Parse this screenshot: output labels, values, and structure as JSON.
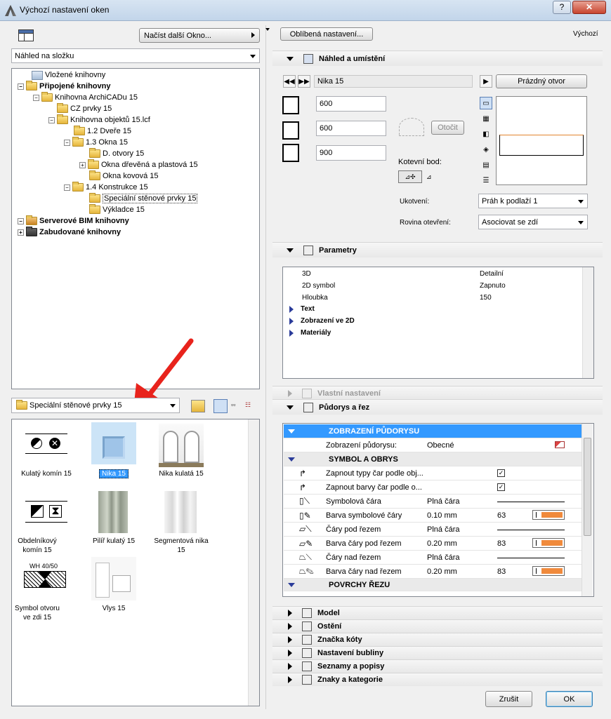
{
  "window": {
    "title": "Výchozí nastavení oken",
    "help": "?",
    "close": "✕"
  },
  "left": {
    "load_button": "Načíst další Okno...",
    "view_mode": "Náhled na složku",
    "tree": [
      {
        "label": "Vložené knihovny",
        "bold": false
      },
      {
        "label": "Připojené knihovny",
        "bold": true
      },
      {
        "label": "Knihovna ArchiCADu 15",
        "bold": false
      },
      {
        "label": "CZ prvky 15",
        "bold": false
      },
      {
        "label": "Knihovna objektů 15.lcf",
        "bold": false
      },
      {
        "label": "1.2 Dveře 15",
        "bold": false
      },
      {
        "label": "1.3 Okna 15",
        "bold": false
      },
      {
        "label": "D. otvory 15",
        "bold": false
      },
      {
        "label": "Okna dřevěná a plastová 15",
        "bold": false
      },
      {
        "label": "Okna kovová 15",
        "bold": false
      },
      {
        "label": "1.4 Konstrukce 15",
        "bold": false
      },
      {
        "label": "Speciální stěnové prvky 15",
        "bold": false
      },
      {
        "label": "Výkladce 15",
        "bold": false
      },
      {
        "label": "Serverové BIM knihovny",
        "bold": true
      },
      {
        "label": "Zabudované knihovny",
        "bold": true
      }
    ],
    "folder_select": "Speciální stěnové prvky 15",
    "items": [
      {
        "label": "Kulatý komín 15"
      },
      {
        "label": "Nika 15"
      },
      {
        "label": "Nika kulatá 15"
      },
      {
        "label": "Obdelníkový komín 15"
      },
      {
        "label": "Pilíř kulatý 15"
      },
      {
        "label": "Segmentová nika 15"
      },
      {
        "label": "Symbol otvoru ve zdi 15",
        "tag": "WH 40/50"
      },
      {
        "label": "Vlys 15"
      }
    ]
  },
  "right": {
    "favorites_button": "Oblíbená nastavení...",
    "default_label": "Výchozí",
    "preview_section": "Náhled a umístění",
    "object_name": "Nika 15",
    "empty_opening": "Prázdný otvor",
    "width": "600",
    "height": "600",
    "depth": "900",
    "rotate": "Otočit",
    "anchor_label": "Kotevní bod:",
    "anchoring_label": "Ukotvení:",
    "anchoring_value": "Práh k podlaží 1",
    "opening_plane_label": "Rovina otevření:",
    "opening_plane_value": "Asociovat se zdí",
    "params_section": "Parametry",
    "params": [
      {
        "name": "3D",
        "value": "Detailní"
      },
      {
        "name": "2D symbol",
        "value": "Zapnuto"
      },
      {
        "name": "Hloubka",
        "value": "150"
      }
    ],
    "param_groups": [
      "Text",
      "Zobrazení ve 2D",
      "Materiály"
    ],
    "custom_section": "Vlastní nastavení",
    "plan_section": "Půdorys a řez",
    "plan_rows": {
      "h1": "ZOBRAZENÍ PŮDORYSU",
      "r1_label": "Zobrazení půdorysu:",
      "r1_value": "Obecné",
      "h2": "SYMBOL A OBRYS",
      "r2_label": "Zapnout typy čar podle obj...",
      "r3_label": "Zapnout barvy čar podle o...",
      "r4_label": "Symbolová čára",
      "r4_value": "Plná čára",
      "r5_label": "Barva symbolové čáry",
      "r5_value": "0.10 mm",
      "r5_num": "63",
      "r6_label": "Čáry pod řezem",
      "r6_value": "Plná čára",
      "r7_label": "Barva čáry pod řezem",
      "r7_value": "0.20 mm",
      "r7_num": "83",
      "r8_label": "Čáry nad řezem",
      "r8_value": "Plná čára",
      "r9_label": "Barva čáry nad řezem",
      "r9_value": "0.20 mm",
      "r9_num": "83",
      "h3": "POVRCHY ŘEZU"
    },
    "collapsed_sections": [
      "Model",
      "Ostění",
      "Značka kóty",
      "Nastavení bubliny",
      "Seznamy a popisy",
      "Znaky a kategorie"
    ],
    "cancel": "Zrušit",
    "ok": "OK"
  },
  "colors": {
    "accent": "#3399ff",
    "arrow": "#e8231c",
    "swatch": "#f08a3c"
  }
}
